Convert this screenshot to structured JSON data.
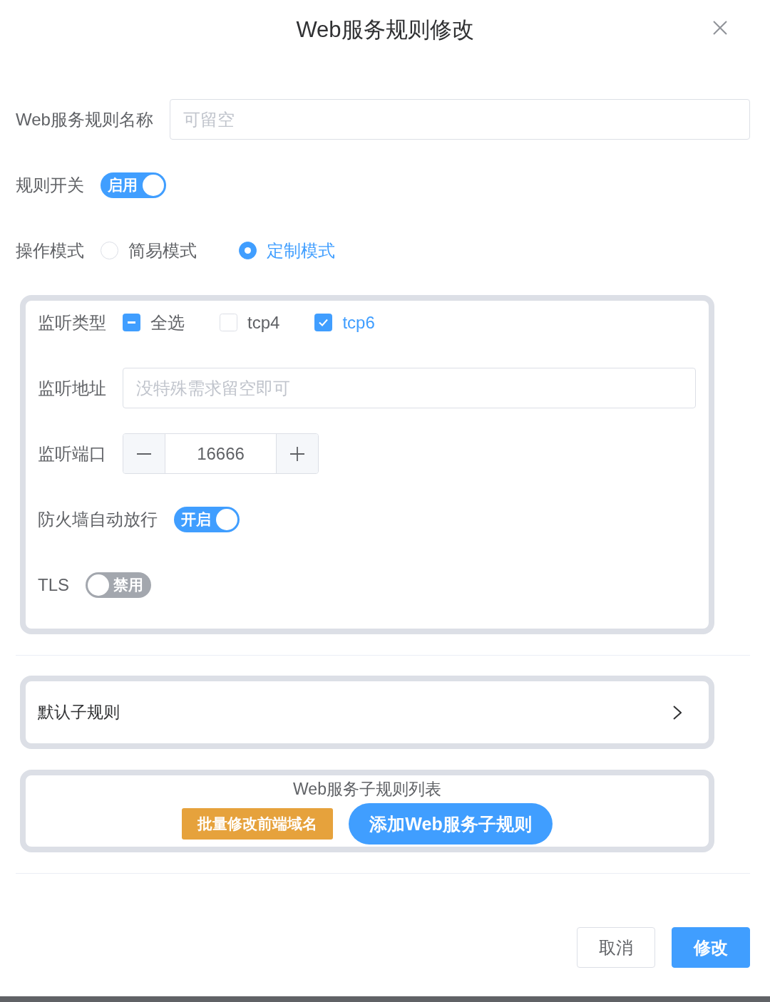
{
  "dialog": {
    "title": "Web服务规则修改"
  },
  "name_field": {
    "label": "Web服务规则名称",
    "placeholder": "可留空"
  },
  "rule_switch": {
    "label": "规则开关",
    "on": true,
    "text": "启用"
  },
  "mode": {
    "label": "操作模式",
    "options": [
      {
        "label": "简易模式",
        "selected": false
      },
      {
        "label": "定制模式",
        "selected": true
      }
    ]
  },
  "listen_panel": {
    "type": {
      "label": "监听类型",
      "options": [
        {
          "label": "全选",
          "checked": false,
          "indeterminate": true
        },
        {
          "label": "tcp4",
          "checked": false,
          "indeterminate": false
        },
        {
          "label": "tcp6",
          "checked": true,
          "indeterminate": false
        }
      ]
    },
    "address": {
      "label": "监听地址",
      "placeholder": "没特殊需求留空即可"
    },
    "port": {
      "label": "监听端口",
      "value": "16666"
    },
    "firewall": {
      "label": "防火墙自动放行",
      "on": true,
      "text": "开启"
    },
    "tls": {
      "label": "TLS",
      "on": false,
      "text": "禁用"
    }
  },
  "default_subrule": {
    "label": "默认子规则"
  },
  "subrule_list": {
    "title": "Web服务子规则列表",
    "buttons": [
      {
        "label": "批量修改前端域名",
        "kind": "warning"
      },
      {
        "label": "添加Web服务子规则",
        "kind": "primary"
      }
    ]
  },
  "footer": {
    "buttons": [
      {
        "label": "取消",
        "kind": "default"
      },
      {
        "label": "修改",
        "kind": "primary"
      }
    ]
  }
}
